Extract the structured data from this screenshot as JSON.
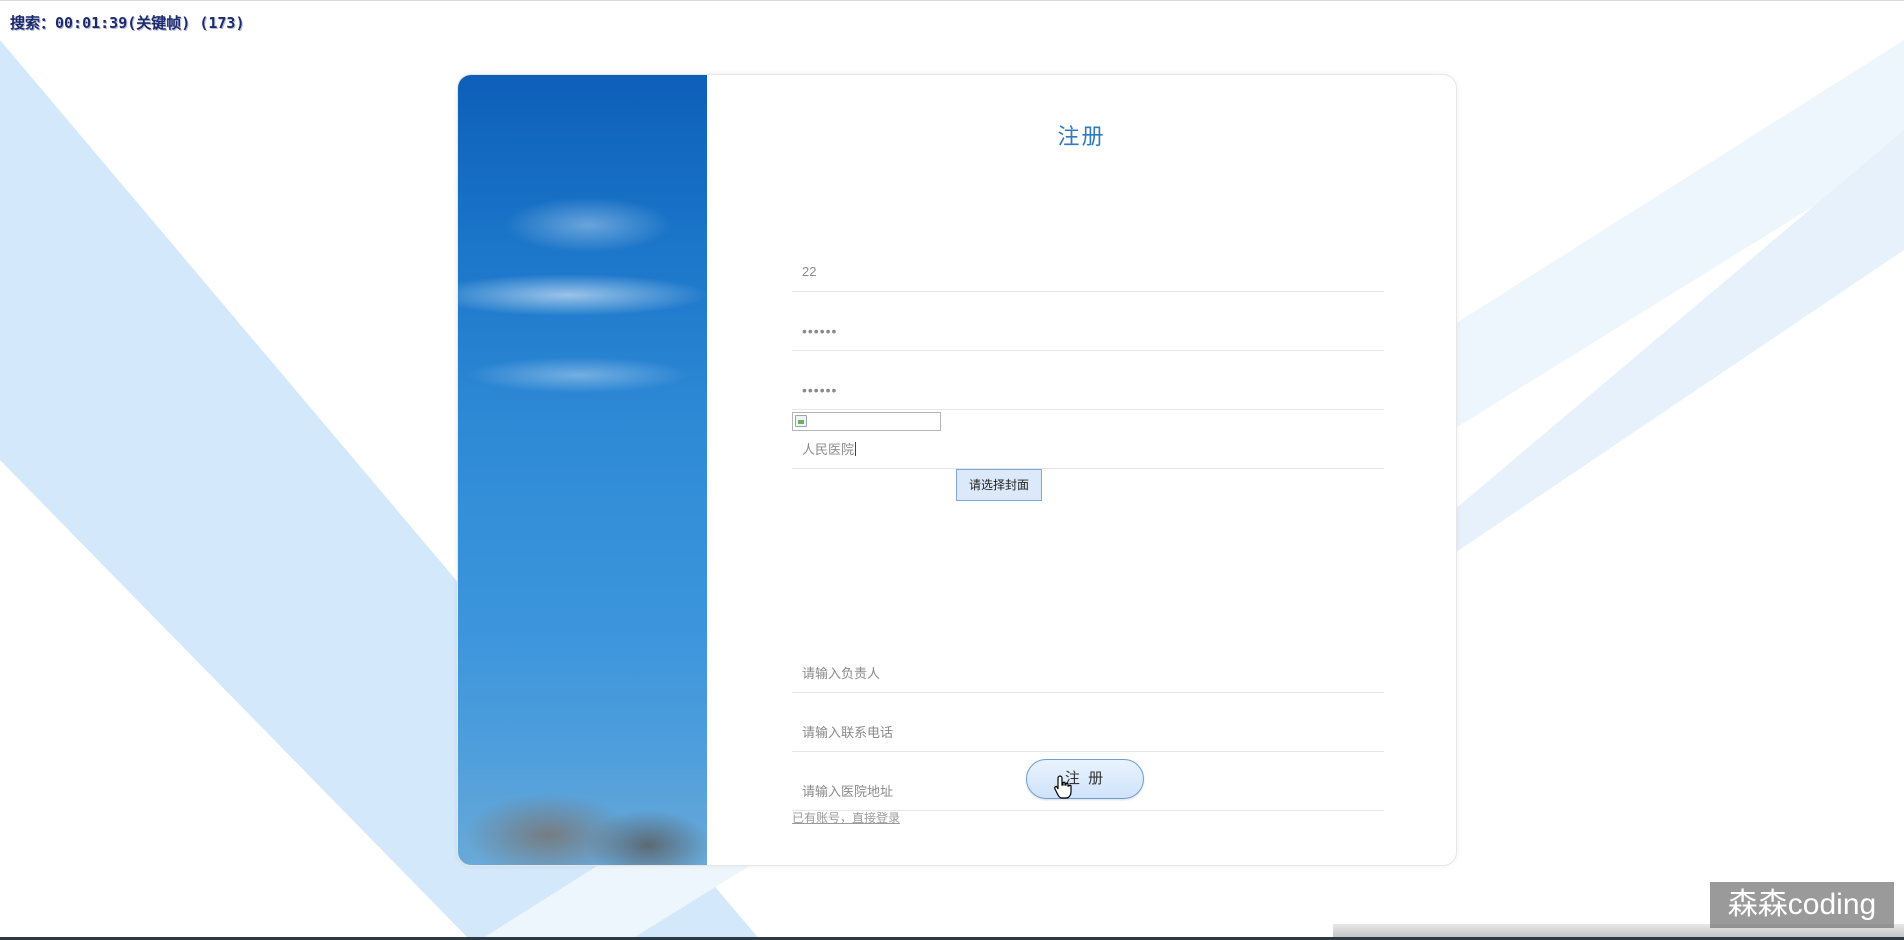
{
  "overlay": {
    "timer_text": "搜索：00:01:39(关键帧) (173)"
  },
  "form": {
    "title": "注册",
    "account_value": "22",
    "password_value": "••••••",
    "confirm_password_value": "••••••",
    "hospital_name_value": "人民医院",
    "select_cover_label": "请选择封面",
    "manager_placeholder": "请输入负责人",
    "phone_placeholder": "请输入联系电话",
    "address_placeholder": "请输入医院地址",
    "submit_label": "注 册",
    "login_link": "已有账号，直接登录"
  },
  "watermark": {
    "text": "森森coding"
  },
  "colors": {
    "title": "#2f7ac0",
    "background_stripe": "#d6e9fb",
    "button_border": "#6f9ed7"
  }
}
